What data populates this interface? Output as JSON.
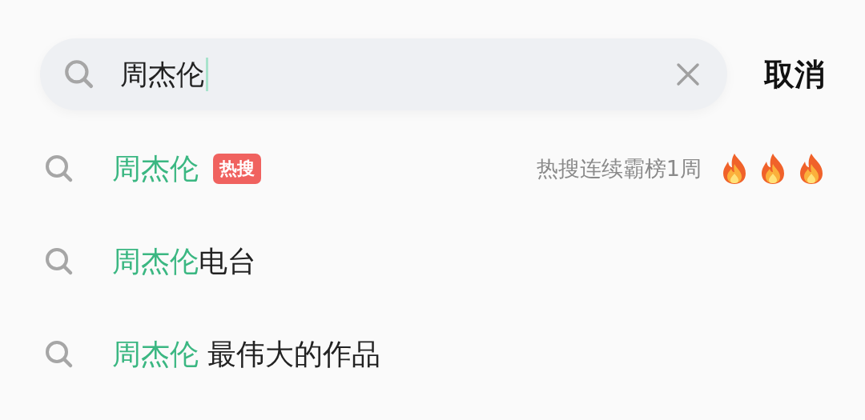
{
  "search": {
    "value": "周杰伦",
    "cursor": true
  },
  "cancel": "取消",
  "suggestions": [
    {
      "match": "周杰伦",
      "badge": "热搜",
      "note": "热搜连续霸榜1周",
      "icons": [
        {
          "kind": "flame"
        },
        {
          "kind": "flame"
        },
        {
          "kind": "flame"
        }
      ]
    },
    {
      "match": "周杰伦",
      "rest": "电台"
    },
    {
      "match": "周杰伦",
      "rest": " 最伟大的作品"
    }
  ]
}
